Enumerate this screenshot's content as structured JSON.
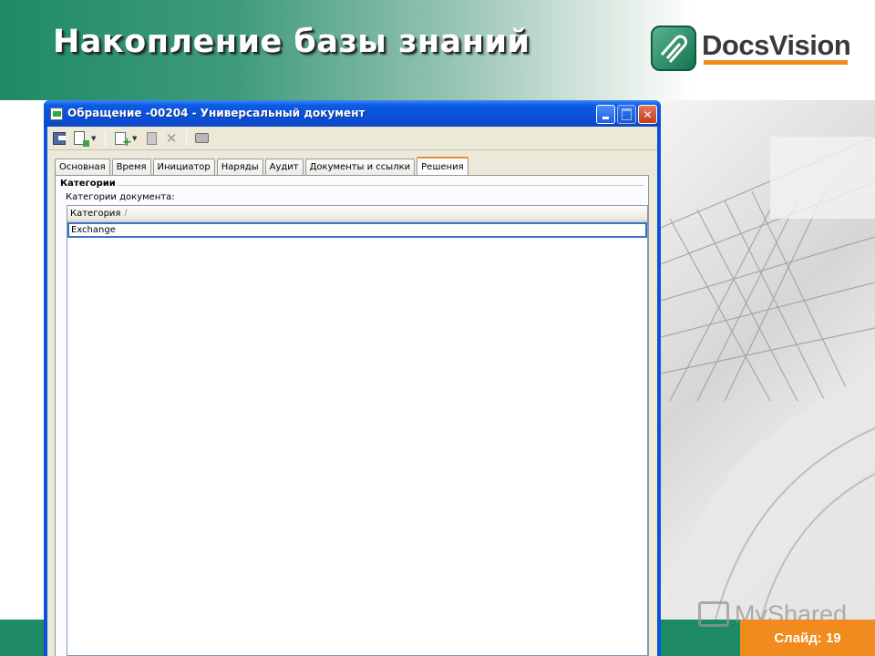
{
  "slide": {
    "title": "Накопление базы знаний",
    "logo_text": "DocsVision",
    "slide_number": "Слайд: 19",
    "watermark": "MyShared"
  },
  "colors": {
    "brand_green": "#1f8a66",
    "accent_orange": "#f08c1e",
    "xp_titlebar_blue": "#0a4fd5",
    "window_face": "#ece9d8"
  },
  "window": {
    "title": "Обращение -00204 - Универсальный документ",
    "icon": "document-app-icon",
    "controls": [
      "minimize-icon",
      "maximize-icon",
      "close-icon"
    ]
  },
  "toolbar": {
    "icons": [
      "save-icon",
      "save-as-icon",
      "new-icon",
      "clipboard-icon",
      "delete-icon",
      "print-icon"
    ]
  },
  "tabs": [
    {
      "label": "Основная",
      "active": false
    },
    {
      "label": "Время",
      "active": false
    },
    {
      "label": "Инициатор",
      "active": false
    },
    {
      "label": "Наряды",
      "active": false
    },
    {
      "label": "Аудит",
      "active": false
    },
    {
      "label": "Документы и ссылки",
      "active": false
    },
    {
      "label": "Решения",
      "active": true
    }
  ],
  "panel": {
    "section_title": "Категории",
    "field_label": "Категории документа:",
    "grid": {
      "columns": [
        "Категория"
      ],
      "sort_indicator": "/",
      "rows": [
        [
          "Exchange"
        ]
      ]
    }
  }
}
